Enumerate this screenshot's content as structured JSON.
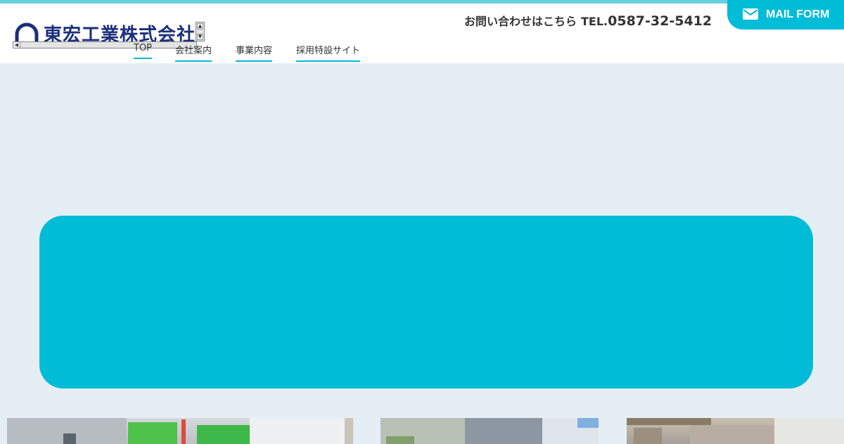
{
  "header": {
    "logo_text": "東宏工業株式会社",
    "contact": {
      "label": "お問い合わせはこちら",
      "tel_prefix": "TEL.",
      "tel_number": "0587-32-5412"
    },
    "mail_button": {
      "label": "MAIL FORM",
      "icon": "envelope-icon"
    }
  },
  "nav": {
    "items": [
      {
        "label": "TOP"
      },
      {
        "label": "会社案内"
      },
      {
        "label": "事業内容"
      },
      {
        "label": "採用特設サイト"
      }
    ]
  },
  "colors": {
    "accent": "#00bcd6",
    "top_stripe": "#66d0e0",
    "page_background": "#e6eef5",
    "logo_navy": "#1b2f7a"
  },
  "photos": [
    {
      "name": "factory-exterior-simulation-photo"
    },
    {
      "name": "factory-interior-photo"
    },
    {
      "name": "facility-photo"
    }
  ]
}
